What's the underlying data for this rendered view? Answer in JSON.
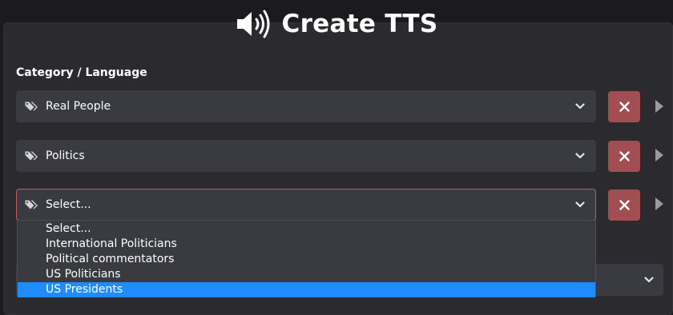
{
  "header": {
    "title": "Create TTS",
    "icon": "speaker-icon"
  },
  "form": {
    "section_label": "Category / Language",
    "selects": [
      {
        "value": "Real People",
        "icon": "tag-icon"
      },
      {
        "value": "Politics",
        "icon": "tag-icon"
      },
      {
        "value": "Select...",
        "icon": "tag-icon",
        "focused": true
      }
    ],
    "dropdown_options": [
      {
        "label": "Select..."
      },
      {
        "label": "International Politicians"
      },
      {
        "label": "Political commentators"
      },
      {
        "label": "US Politicians"
      },
      {
        "label": "US Presidents",
        "highlighted": true
      }
    ]
  },
  "colors": {
    "background": "#1b1b1e",
    "panel": "#2a2a2f",
    "select_bg": "#3a3a41",
    "remove_button": "#a14d52",
    "focus_border": "#c95b60",
    "option_highlight": "#1e8cff"
  }
}
